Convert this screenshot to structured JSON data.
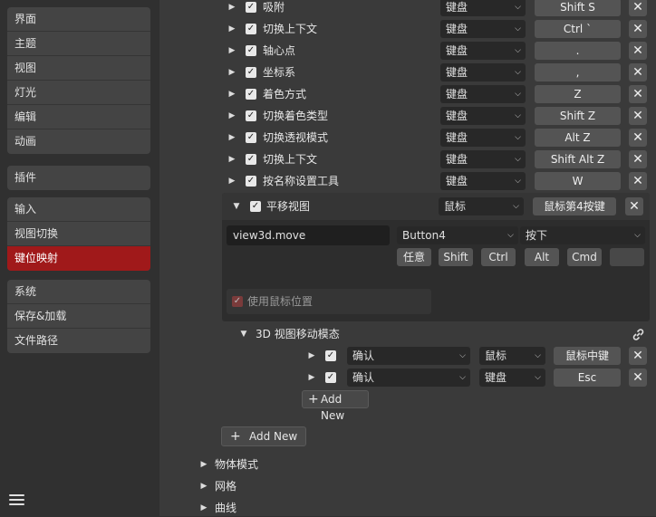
{
  "sidebar": {
    "group1": [
      "界面",
      "主题",
      "视图",
      "灯光",
      "编辑",
      "动画"
    ],
    "group2": [
      "插件"
    ],
    "group3": [
      "输入",
      "视图切换",
      "键位映射"
    ],
    "group4": [
      "系统",
      "保存&加载",
      "文件路径"
    ],
    "active": "键位映射"
  },
  "keymap_items": [
    {
      "name": "吸附",
      "type": "键盘",
      "key": "Shift S"
    },
    {
      "name": "切换上下文",
      "type": "键盘",
      "key": "Ctrl `"
    },
    {
      "name": "轴心点",
      "type": "键盘",
      "key": "."
    },
    {
      "name": "坐标系",
      "type": "键盘",
      "key": ","
    },
    {
      "name": "着色方式",
      "type": "键盘",
      "key": "Z"
    },
    {
      "name": "切换着色类型",
      "type": "键盘",
      "key": "Shift Z"
    },
    {
      "name": "切换透视模式",
      "type": "键盘",
      "key": "Alt Z"
    },
    {
      "name": "切换上下文",
      "type": "键盘",
      "key": "Shift Alt Z"
    },
    {
      "name": "按名称设置工具",
      "type": "键盘",
      "key": "W"
    }
  ],
  "expanded": {
    "name": "平移视图",
    "type": "鼠标",
    "key": "鼠标第4按键",
    "operator": "view3d.move",
    "button": "Button4",
    "action": "按下",
    "modifiers": [
      "任意",
      "Shift",
      "Ctrl",
      "Alt",
      "Cmd"
    ],
    "use_mouse_position": "使用鼠标位置"
  },
  "modal": {
    "title": "3D 视图移动模态",
    "items": [
      {
        "name": "确认",
        "type": "鼠标",
        "key": "鼠标中键"
      },
      {
        "name": "确认",
        "type": "键盘",
        "key": "Esc"
      }
    ],
    "add_new": "Add New"
  },
  "add_new": "Add New",
  "categories": [
    "物体模式",
    "网格",
    "曲线"
  ],
  "glyphs": {
    "tri_right": "▶",
    "tri_down": "▼",
    "check": "✓",
    "x": "✕",
    "arrow": "⌵",
    "plus": "+"
  }
}
